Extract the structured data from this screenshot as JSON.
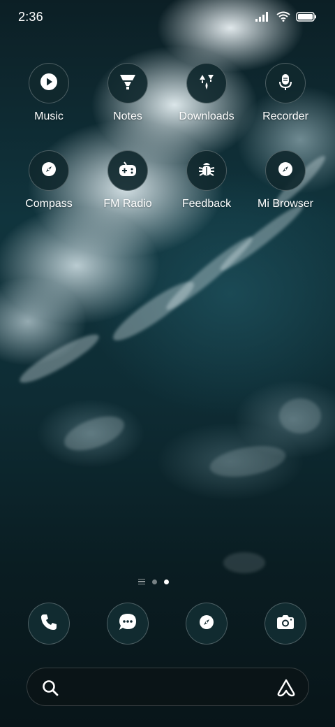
{
  "status_bar": {
    "time": "2:36",
    "icons": [
      "signal-icon",
      "wifi-icon",
      "battery-icon"
    ]
  },
  "apps": [
    {
      "label": "Music",
      "icon": "play-icon"
    },
    {
      "label": "Notes",
      "icon": "notes-icon"
    },
    {
      "label": "Downloads",
      "icon": "downloads-icon"
    },
    {
      "label": "Recorder",
      "icon": "microphone-icon"
    },
    {
      "label": "Compass",
      "icon": "compass-icon"
    },
    {
      "label": "FM Radio",
      "icon": "gamepad-icon"
    },
    {
      "label": "Feedback",
      "icon": "bug-icon"
    },
    {
      "label": "Mi Browser",
      "icon": "compass-icon"
    }
  ],
  "pager": {
    "pages": 2,
    "active": 2
  },
  "dock": [
    {
      "icon": "phone-icon"
    },
    {
      "icon": "messages-icon"
    },
    {
      "icon": "browser-icon"
    },
    {
      "icon": "camera-icon"
    }
  ],
  "search": {
    "placeholder": "",
    "value": ""
  },
  "colors": {
    "icon_bg": "#10282e",
    "text": "#ffffff"
  }
}
